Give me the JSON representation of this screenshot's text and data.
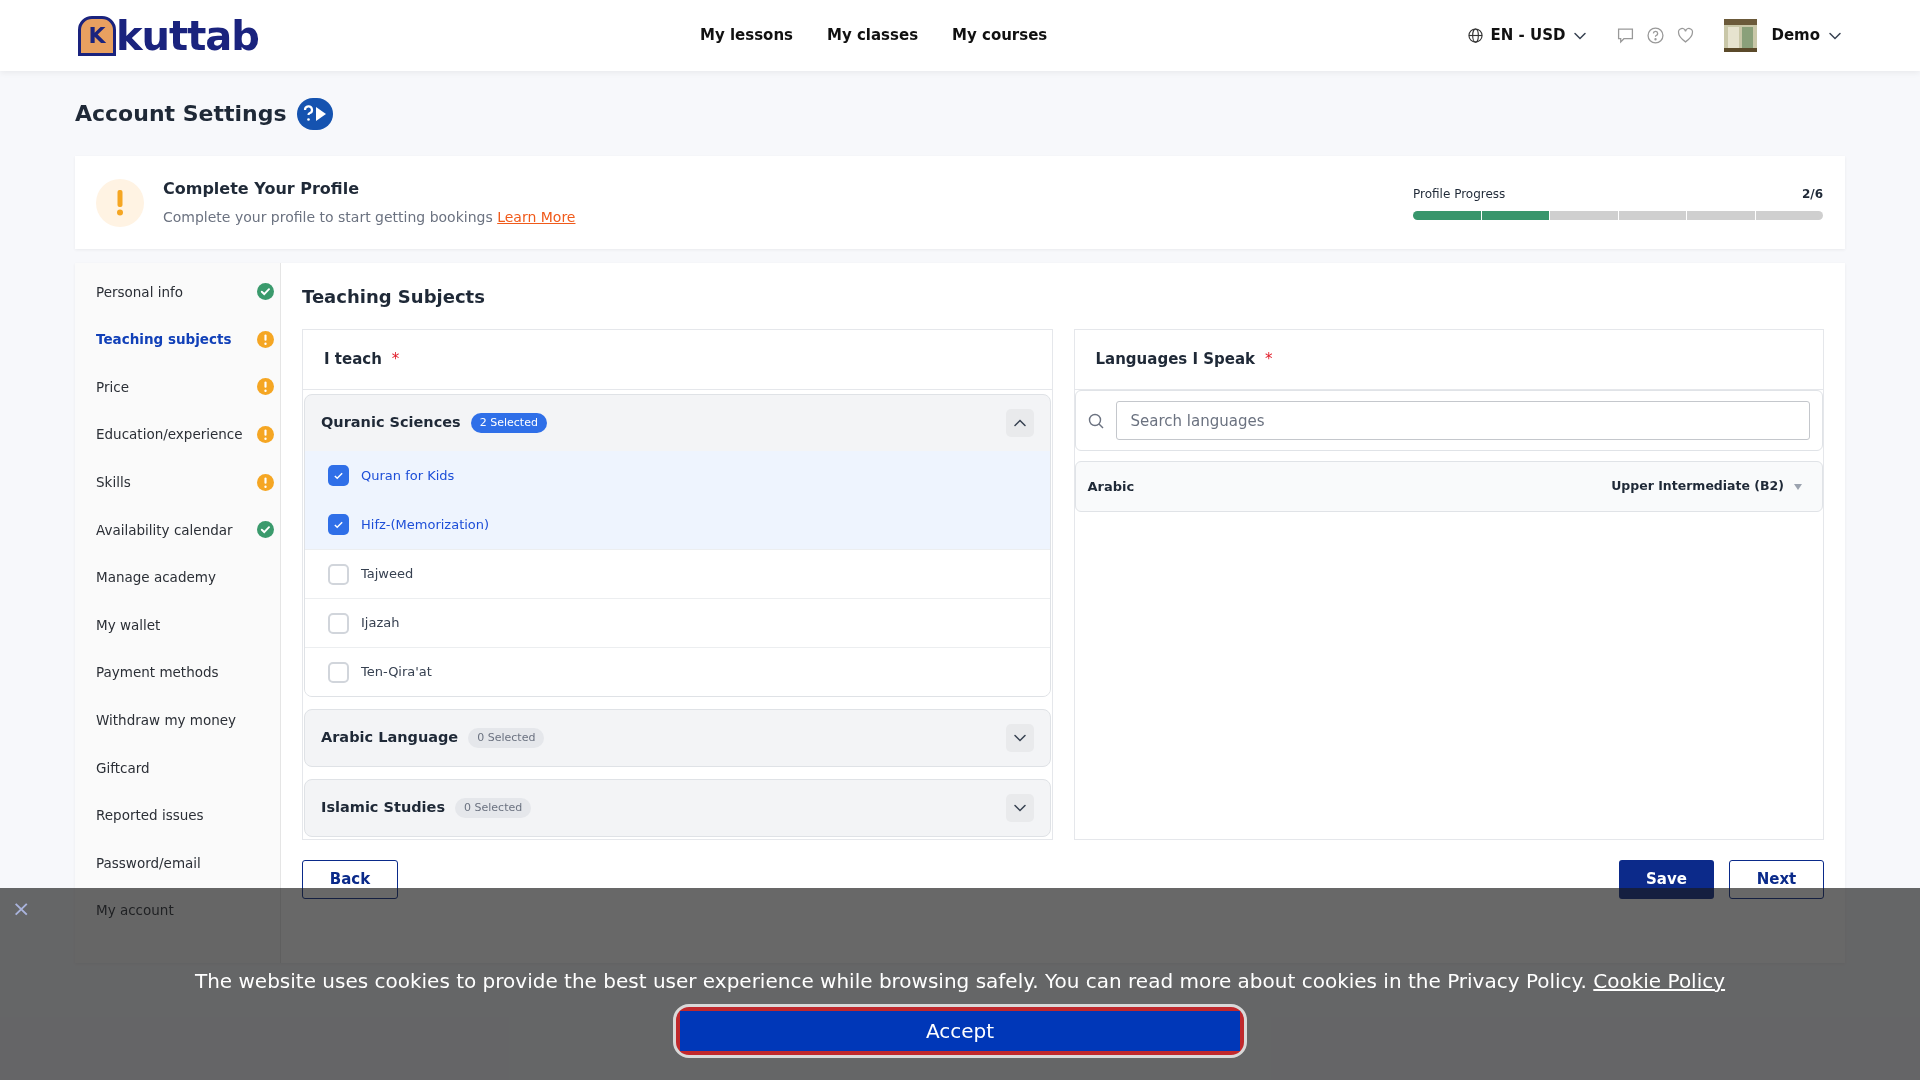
{
  "header": {
    "logo": {
      "mark": "K",
      "text": "kuttab"
    },
    "nav": [
      "My lessons",
      "My classes",
      "My courses"
    ],
    "locale": "EN - USD",
    "user": "Demo"
  },
  "page_title": "Account Settings",
  "profile_banner": {
    "title": "Complete Your Profile",
    "text": "Complete your profile to start getting bookings",
    "link": "Learn More",
    "progress_label": "Profile Progress",
    "progress_count": "2/6",
    "level": 0.3333
  },
  "sidebar": {
    "items": [
      {
        "label": "Personal info",
        "selected": false,
        "complete": true
      },
      {
        "label": "Teaching subjects",
        "selected": true,
        "complete": false
      },
      {
        "label": "Price",
        "selected": false,
        "complete": false
      },
      {
        "label": "Education/experience",
        "selected": false,
        "complete": false
      },
      {
        "label": "Skills",
        "selected": false,
        "complete": false
      },
      {
        "label": "Availability calendar",
        "selected": false,
        "complete": true
      },
      {
        "label": "Manage academy",
        "selected": false
      },
      {
        "label": "My wallet",
        "selected": false
      },
      {
        "label": "Payment methods",
        "selected": false
      },
      {
        "label": "Withdraw my money",
        "selected": false
      },
      {
        "label": "Giftcard",
        "selected": false
      },
      {
        "label": "Reported issues",
        "selected": false
      },
      {
        "label": "Password/email",
        "selected": false
      },
      {
        "label": "My account",
        "selected": false
      }
    ]
  },
  "section_title": "Teaching Subjects",
  "teach_panel": {
    "title": "I teach",
    "required": "*",
    "groups": [
      {
        "title": "Quranic Sciences",
        "badge": "2 Selected",
        "expanded": true,
        "items": [
          {
            "label": "Quran for Kids",
            "checked": true
          },
          {
            "label": "Hifz-(Memorization)",
            "checked": true
          },
          {
            "label": "Tajweed",
            "checked": false
          },
          {
            "label": "Ijazah",
            "checked": false
          },
          {
            "label": "Ten-Qira'at",
            "checked": false
          }
        ]
      },
      {
        "title": "Arabic Language",
        "badge": "0 Selected",
        "expanded": false
      },
      {
        "title": "Islamic Studies",
        "badge": "0 Selected",
        "expanded": false
      }
    ]
  },
  "languages_panel": {
    "title": "Languages I Speak",
    "required": "*",
    "search": {
      "placeholder": "Search languages"
    },
    "languages": [
      {
        "name": "Arabic",
        "level_label": "Upper Intermediate (B2)"
      }
    ]
  },
  "buttons": {
    "back": "Back",
    "save": "Save",
    "next": "Next"
  },
  "cookie_banner": {
    "close": "×",
    "text": "The website uses cookies to provide the best user experience while browsing safely. You can read more about cookies in the Privacy Policy.",
    "link": "Cookie Policy",
    "accept": "Accept"
  }
}
